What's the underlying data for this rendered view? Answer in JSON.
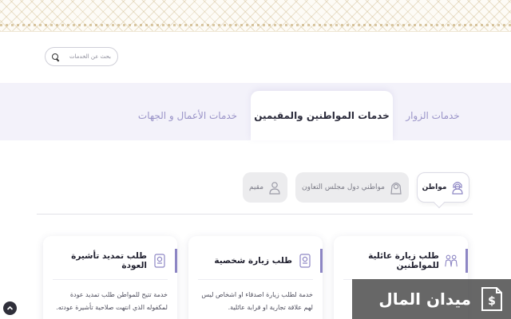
{
  "search": {
    "placeholder": "بحث عن الخدمات"
  },
  "tabs": [
    {
      "label": "خدمات الزوار",
      "active": false
    },
    {
      "label": "خدمات المواطنين والمقيمين",
      "active": true
    },
    {
      "label": "خدمات الأعمال و الجهات",
      "active": false
    }
  ],
  "segments": [
    {
      "label": "مواطن",
      "icon": "citizen-person-icon",
      "active": true
    },
    {
      "label": "مواطني دول مجلس التعاون",
      "icon": "gcc-citizen-person-icon",
      "active": false
    },
    {
      "label": "مقيم",
      "icon": "resident-person-icon",
      "active": false
    }
  ],
  "cards": [
    {
      "title": "طلب زيارة عائلية للمواطنين",
      "icon": "family-icon",
      "description": ""
    },
    {
      "title": "طلب زيارة شخصية",
      "icon": "passport-icon",
      "description": "خدمة لطلب زيارة اصدقاء او اشخاص ليس لهم علاقة تجارية او قرابة عائلية."
    },
    {
      "title": "طلب تمديد تأشيرة العودة",
      "icon": "passport-icon",
      "description": "خدمة تتيح للمواطن طلب تمديد عودة لمكفوله الذي انتهت صلاحية تأشيرة عودته."
    }
  ],
  "watermark": {
    "text": "ميدان المال",
    "icon": "dollar-document-icon"
  },
  "scroll_top": {
    "icon": "chevron-up-icon"
  },
  "colors": {
    "accent": "#8d86c4",
    "tab_inactive": "#9a94c8",
    "band": "#f3f2fa"
  }
}
